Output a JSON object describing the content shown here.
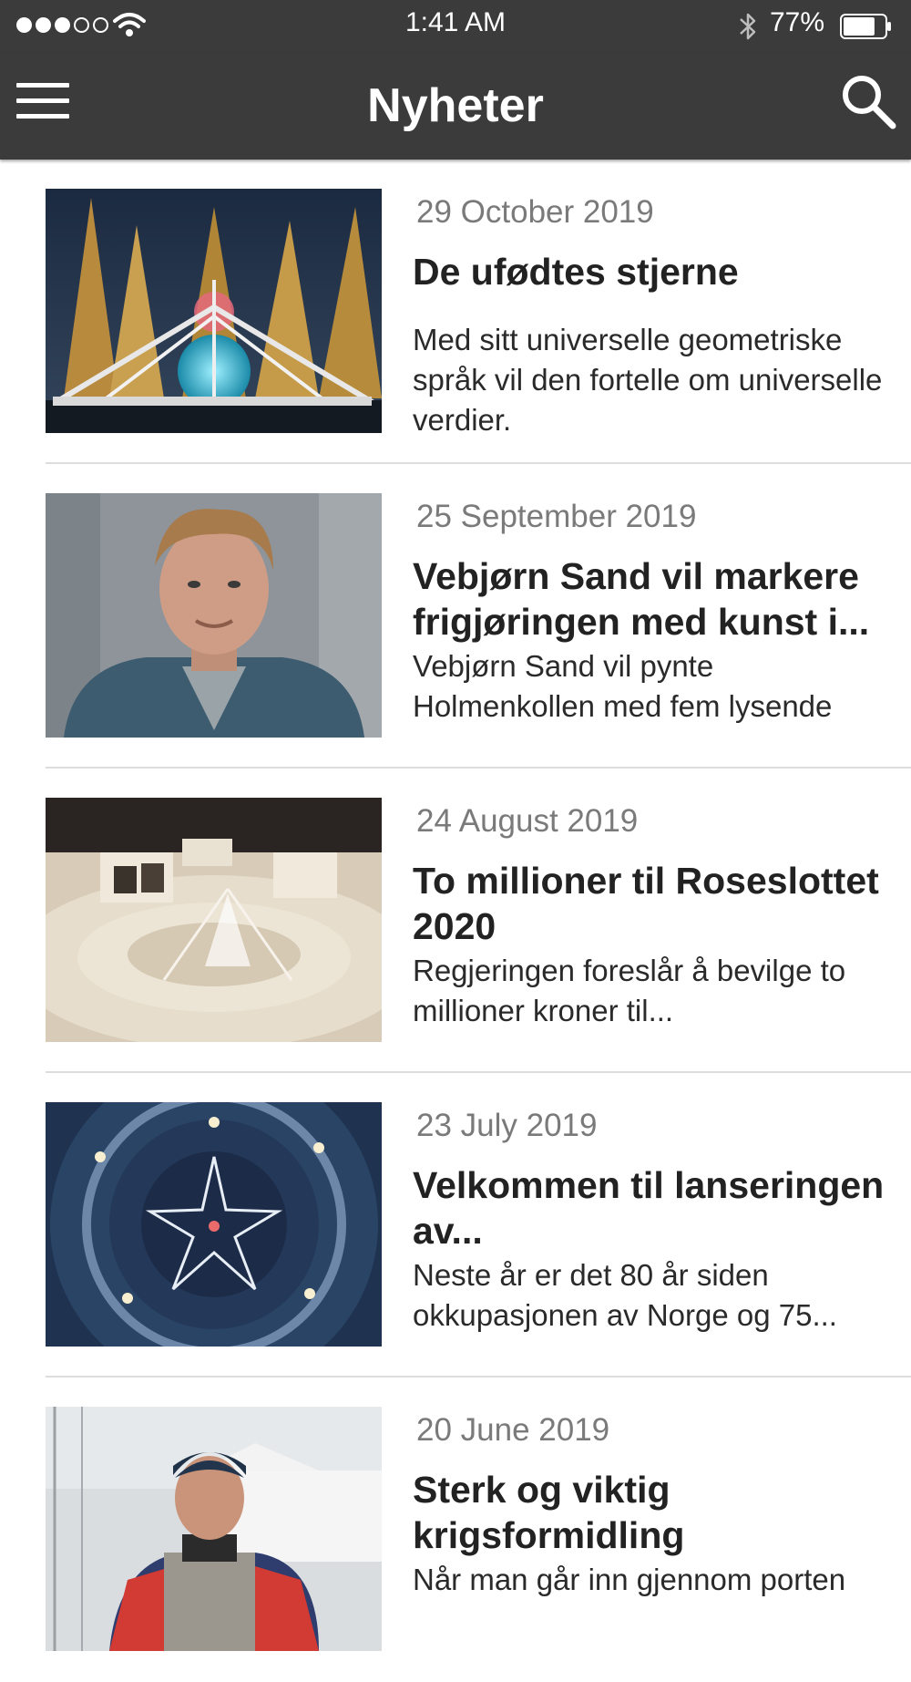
{
  "status_bar": {
    "time": "1:41 AM",
    "battery_percent": "77%",
    "battery_level": 0.77,
    "signal_bars_filled": 3,
    "signal_bars_total": 5,
    "icons": [
      "signal-dots-icon",
      "wifi-icon",
      "bluetooth-icon",
      "battery-icon"
    ]
  },
  "header": {
    "title": "Nyheter",
    "menu_icon": "hamburger-menu-icon",
    "search_icon": "search-icon"
  },
  "colors": {
    "bar_background": "#3b3b3b",
    "bar_text": "#ffffff",
    "date_text": "#7a7a7a",
    "headline_text": "#222222",
    "divider": "#dddddd"
  },
  "articles": [
    {
      "date": "29 October 2019",
      "title": "De ufødtes stjerne",
      "summary": "Med sitt universelle geometriske språk vil den fortelle om universelle verdier."
    },
    {
      "date": "25 September 2019",
      "title": "Vebjørn Sand vil markere frigjøringen med kunst i...",
      "summary": "Vebjørn Sand vil pynte Holmenkollen med fem lysende"
    },
    {
      "date": "24 August 2019",
      "title": "To millioner til Roseslottet 2020",
      "summary": "Regjeringen foreslår å bevilge to millioner kroner til..."
    },
    {
      "date": "23 July 2019",
      "title": "Velkommen til lanseringen av...",
      "summary": "Neste år er det 80 år siden okkupasjonen av Norge og 75..."
    },
    {
      "date": "20 June 2019",
      "title": "Sterk og viktig krigsformidling",
      "summary": "Når man går inn gjennom porten"
    }
  ]
}
